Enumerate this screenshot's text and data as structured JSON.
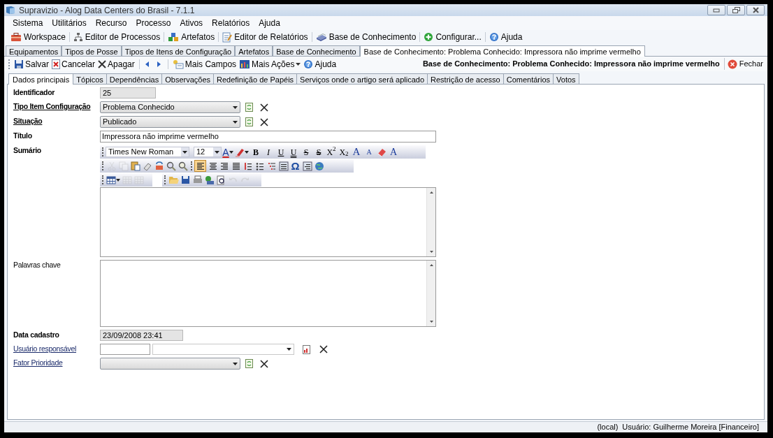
{
  "window": {
    "title": "Supravizio - Alog Data Centers do Brasil - 7.1.1"
  },
  "menu": [
    "Sistema",
    "Utilitários",
    "Recurso",
    "Processo",
    "Ativos",
    "Relatórios",
    "Ajuda"
  ],
  "toolbar": [
    "Workspace",
    "Editor de Processos",
    "Artefatos",
    "Editor de Relatórios",
    "Base de Conhecimento",
    "Configurar...",
    "Ajuda"
  ],
  "doc_tabs": [
    {
      "label": "Equipamentos",
      "selected": false
    },
    {
      "label": "Tipos de Posse",
      "selected": false
    },
    {
      "label": "Tipos de Itens de Configuração",
      "selected": false
    },
    {
      "label": "Artefatos",
      "selected": false
    },
    {
      "label": "Base de Conhecimento",
      "selected": false
    },
    {
      "label": "Base de Conhecimento: Problema Conhecido: Impressora não imprime vermelho",
      "selected": true
    }
  ],
  "actions": [
    "Salvar",
    "Cancelar",
    "Apagar",
    "Mais Campos",
    "Mais Ações",
    "Ajuda"
  ],
  "heading": "Base de Conhecimento: Problema Conhecido: Impressora não imprime vermelho",
  "close_label": "Fechar",
  "form_tabs": [
    {
      "label": "Dados principais",
      "selected": true
    },
    {
      "label": "Tópicos",
      "selected": false
    },
    {
      "label": "Dependências",
      "selected": false
    },
    {
      "label": "Observações",
      "selected": false
    },
    {
      "label": "Redefinição de Papéis",
      "selected": false
    },
    {
      "label": "Serviços onde o artigo será aplicado",
      "selected": false
    },
    {
      "label": "Restrição de acesso",
      "selected": false
    },
    {
      "label": "Comentários",
      "selected": false
    },
    {
      "label": "Votos",
      "selected": false
    }
  ],
  "fields": [
    {
      "kind": "readonly",
      "label": "Identificador",
      "bold": true,
      "link": false,
      "value": "25"
    },
    {
      "kind": "select",
      "label": "Tipo Item Configuração",
      "bold": true,
      "link": true,
      "value": "Problema Conhecido"
    },
    {
      "kind": "select",
      "label": "Situação",
      "bold": true,
      "link": true,
      "value": "Publicado"
    },
    {
      "kind": "text",
      "label": "Título",
      "bold": true,
      "link": false,
      "value": "Impressora não imprime vermelho"
    },
    {
      "kind": "editor",
      "label": "Sumário",
      "bold": true,
      "link": false
    },
    {
      "kind": "textarea",
      "label": "Palavras chave",
      "bold": false,
      "link": false
    },
    {
      "kind": "readonly",
      "label": "Data cadastro",
      "bold": true,
      "link": false,
      "value": "23/09/2008 23:41"
    },
    {
      "kind": "user",
      "label": "Usuário responsável",
      "bold": false,
      "link": true
    },
    {
      "kind": "select",
      "label": "Fator Prioridade",
      "bold": false,
      "link": true
    }
  ],
  "editor": {
    "font": "Times New Roman",
    "size": "12",
    "format_buttons": [
      "A",
      "B",
      "I",
      "U",
      "U",
      "S",
      "S",
      "X$^{2}$",
      "X$_{2}$",
      "A",
      "A",
      "A"
    ],
    "row2": [
      {
        "disabled": true,
        "selected": false
      },
      {
        "disabled": true,
        "selected": false
      },
      {
        "disabled": false,
        "selected": false
      },
      {
        "disabled": false,
        "selected": false
      },
      {
        "disabled": false,
        "selected": false
      },
      {
        "disabled": false,
        "selected": false
      },
      {
        "disabled": false,
        "selected": false
      },
      {
        "disabled": false,
        "selected": true
      },
      {
        "disabled": false,
        "selected": false
      },
      {
        "disabled": false,
        "selected": false
      },
      {
        "disabled": false,
        "selected": false
      },
      {
        "disabled": false,
        "selected": false
      },
      {
        "disabled": false,
        "selected": false
      },
      {
        "disabled": false,
        "selected": false
      },
      {
        "disabled": false,
        "selected": false
      },
      {
        "disabled": false,
        "selected": false
      },
      {
        "disabled": false,
        "selected": false
      }
    ],
    "omega": "Ω",
    "row3": [
      {
        "disabled": false
      },
      {
        "disabled": true
      },
      {
        "disabled": true
      },
      {
        "disabled": false
      },
      {
        "disabled": false
      },
      {
        "disabled": false
      },
      {
        "disabled": false
      },
      {
        "disabled": false
      },
      {
        "disabled": true
      },
      {
        "disabled": true
      }
    ]
  },
  "status": [
    "(local)",
    "Usuário: Guilherme Moreira [Financeiro]"
  ]
}
